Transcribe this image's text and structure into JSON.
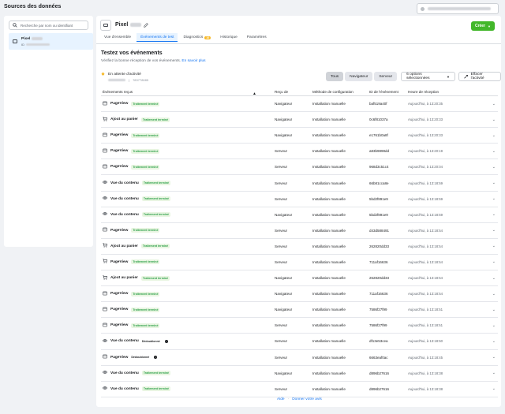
{
  "page_title": "Sources des données",
  "left": {
    "search_placeholder": "Recherche par nom ou identifiant",
    "pixel_name": "Pixel",
    "pixel_id_prefix": "ID"
  },
  "header": {
    "title": "Pixel",
    "create_label": "Créer",
    "tabs": [
      {
        "label": "Vue d'ensemble",
        "active": false
      },
      {
        "label": "Événements de test",
        "active": true
      },
      {
        "label": "Diagnostics",
        "badge": "10",
        "active": false
      },
      {
        "label": "Historique",
        "active": false
      },
      {
        "label": "Paramètres",
        "active": false
      }
    ]
  },
  "test": {
    "title": "Testez vos événements",
    "desc": "Vérifiez la bonne réception de vos événements.",
    "learn_more": "En savoir plus",
    "waiting": "En attente d'activité",
    "waiting_id": "783778085"
  },
  "filters": {
    "all": "Tous",
    "browser": "Navigateur",
    "server": "Serveur",
    "options": "6 options sélectionnées",
    "clear": "Effacer l'activité"
  },
  "table": {
    "headers": {
      "events": "Événements reçus",
      "received": "Reçu de",
      "method": "Méthode de configuration",
      "event_id": "ID de l'événement",
      "time": "Heure de réception"
    },
    "rows": [
      {
        "icon": "pageview",
        "name": "PageView",
        "status": "Traitement terminé",
        "from": "Navigateur",
        "method": "Installation manuelle",
        "id": "baf519a40f",
        "time": "Aujourd'hui, à 13:20:35"
      },
      {
        "icon": "cart",
        "name": "Ajout au panier",
        "status": "Traitement terminé",
        "from": "Navigateur",
        "method": "Installation manuelle",
        "id": "0c6f81037a",
        "time": "Aujourd'hui, à 13:20:33"
      },
      {
        "icon": "pageview",
        "name": "PageView",
        "status": "Traitement terminé",
        "from": "Navigateur",
        "method": "Installation manuelle",
        "id": "e1761b0a8f",
        "time": "Aujourd'hui, à 13:20:33"
      },
      {
        "icon": "pageview",
        "name": "PageView",
        "status": "Traitement terminé",
        "from": "Serveur",
        "method": "Installation manuelle",
        "id": "a83b9898dd",
        "time": "Aujourd'hui, à 13:20:19"
      },
      {
        "icon": "pageview",
        "name": "PageView",
        "status": "Traitement terminé",
        "from": "Serveur",
        "method": "Installation manuelle",
        "id": "968d3c51c4",
        "time": "Aujourd'hui, à 13:20:04"
      },
      {
        "icon": "view",
        "name": "Vue du contenu",
        "status": "Traitement terminé",
        "from": "Serveur",
        "method": "Installation manuelle",
        "id": "66b81cca8e",
        "time": "Aujourd'hui, à 13:18:59"
      },
      {
        "icon": "view",
        "name": "Vue du contenu",
        "status": "Traitement terminé",
        "from": "Serveur",
        "method": "Installation manuelle",
        "id": "5bd2f891e9",
        "time": "Aujourd'hui, à 13:18:59"
      },
      {
        "icon": "view",
        "name": "Vue du contenu",
        "status": "Traitement terminé",
        "from": "Navigateur",
        "method": "Installation manuelle",
        "id": "5bd2f891e9",
        "time": "Aujourd'hui, à 13:18:59"
      },
      {
        "icon": "pageview",
        "name": "PageView",
        "status": "Traitement terminé",
        "from": "Serveur",
        "method": "Installation manuelle",
        "id": "d43d588491",
        "time": "Aujourd'hui, à 13:18:54"
      },
      {
        "icon": "cart",
        "name": "Ajout au panier",
        "status": "Traitement terminé",
        "from": "Serveur",
        "method": "Installation manuelle",
        "id": "262820dd33",
        "time": "Aujourd'hui, à 13:18:54"
      },
      {
        "icon": "cart",
        "name": "PageView",
        "status": "Traitement terminé",
        "from": "Serveur",
        "method": "Installation manuelle",
        "id": "711af16636",
        "time": "Aujourd'hui, à 13:18:54"
      },
      {
        "icon": "cart",
        "name": "Ajout au panier",
        "status": "Traitement terminé",
        "from": "Navigateur",
        "method": "Installation manuelle",
        "id": "262820dd33",
        "time": "Aujourd'hui, à 13:18:54"
      },
      {
        "icon": "pageview",
        "name": "PageView",
        "status": "Traitement terminé",
        "from": "Navigateur",
        "method": "Installation manuelle",
        "id": "711af16636",
        "time": "Aujourd'hui, à 13:18:54"
      },
      {
        "icon": "pageview",
        "name": "PageView",
        "status": "Traitement terminé",
        "from": "Navigateur",
        "method": "Installation manuelle",
        "id": "7586f27f99",
        "time": "Aujourd'hui, à 13:18:51"
      },
      {
        "icon": "pageview",
        "name": "PageView",
        "status": "Traitement terminé",
        "from": "Serveur",
        "method": "Installation manuelle",
        "id": "7586f27f99",
        "time": "Aujourd'hui, à 13:18:51"
      },
      {
        "icon": "view",
        "name": "Vue du contenu",
        "status": "Dédoublonné",
        "dedup": true,
        "from": "Serveur",
        "method": "Installation manuelle",
        "id": "df13e53cea",
        "time": "Aujourd'hui, à 13:18:50"
      },
      {
        "icon": "pageview",
        "name": "PageView",
        "status": "Dédoublonné",
        "dedup": true,
        "from": "Serveur",
        "method": "Installation manuelle",
        "id": "6663eaf0ac",
        "time": "Aujourd'hui, à 13:18:45"
      },
      {
        "icon": "view",
        "name": "Vue du contenu",
        "status": "Traitement terminé",
        "from": "Navigateur",
        "method": "Installation manuelle",
        "id": "d896b27616",
        "time": "Aujourd'hui, à 13:18:38"
      },
      {
        "icon": "view",
        "name": "Vue du contenu",
        "status": "Traitement terminé",
        "from": "Serveur",
        "method": "Installation manuelle",
        "id": "d896b27616",
        "time": "Aujourd'hui, à 13:18:38"
      }
    ]
  },
  "footer": {
    "help": "Aide",
    "sep": "·",
    "feedback": "Donner votre avis"
  }
}
